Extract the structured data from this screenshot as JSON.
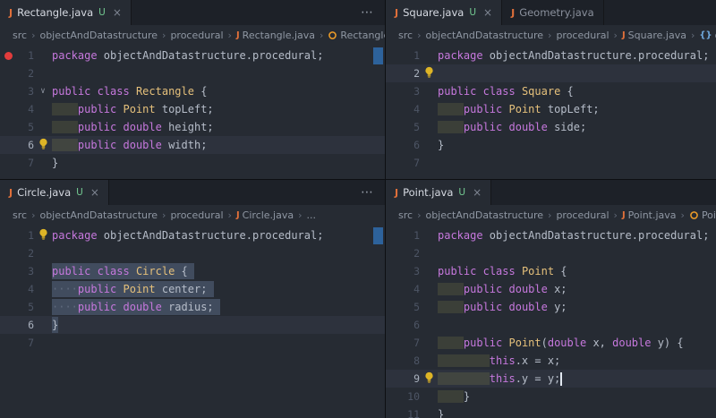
{
  "breadcrumb_separator": "›",
  "icons": {
    "java": "J",
    "namespace": "{}",
    "fold": "∨"
  },
  "colors": {
    "accent_blue": "#2f6cae",
    "git_untracked": "#73c991",
    "keyword": "#c678dd",
    "type": "#e5c07b",
    "lightbulb": "#ddb426",
    "breakpoint": "#e23c3c"
  },
  "panes": [
    {
      "name": "rectangle",
      "tabs": [
        {
          "label": "Rectangle.java",
          "badge": "U",
          "close": "×",
          "active": true
        }
      ],
      "actions": "⋯",
      "breadcrumb": [
        {
          "label": "src"
        },
        {
          "label": "objectAndDatastructure"
        },
        {
          "label": "procedural"
        },
        {
          "label": "Rectangle.java",
          "icon": "java"
        },
        {
          "label": "Rectangle",
          "icon": "class"
        }
      ],
      "scroll_marker": true,
      "lines": [
        {
          "n": 1,
          "breakpoint": true,
          "tokens": [
            [
              "kw",
              "package"
            ],
            [
              "pl",
              " objectAndDatastructure.procedural;"
            ]
          ]
        },
        {
          "n": 2
        },
        {
          "n": 3,
          "fold": true,
          "tokens": [
            [
              "kw",
              "public"
            ],
            [
              "pl",
              " "
            ],
            [
              "kw",
              "class"
            ],
            [
              "pl",
              " "
            ],
            [
              "ty",
              "Rectangle"
            ],
            [
              "pl",
              " {"
            ]
          ]
        },
        {
          "n": 4,
          "tokens": [
            [
              "ws",
              "    "
            ],
            [
              "kw",
              "public"
            ],
            [
              "pl",
              " "
            ],
            [
              "ty",
              "Point"
            ],
            [
              "pl",
              " topLeft;"
            ]
          ]
        },
        {
          "n": 5,
          "tokens": [
            [
              "ws",
              "    "
            ],
            [
              "kw",
              "public"
            ],
            [
              "pl",
              " "
            ],
            [
              "kw",
              "double"
            ],
            [
              "pl",
              " height;"
            ]
          ]
        },
        {
          "n": 6,
          "bulb": true,
          "current": true,
          "tokens": [
            [
              "ws",
              "    "
            ],
            [
              "kw",
              "public"
            ],
            [
              "pl",
              " "
            ],
            [
              "kw",
              "double"
            ],
            [
              "pl",
              " width;"
            ]
          ]
        },
        {
          "n": 7,
          "tokens": [
            [
              "pl",
              "}"
            ]
          ]
        }
      ]
    },
    {
      "name": "square",
      "tabs": [
        {
          "label": "Square.java",
          "badge": "U",
          "close": "×",
          "active": true
        },
        {
          "label": "Geometry.java",
          "active": false
        }
      ],
      "actions": null,
      "breadcrumb": [
        {
          "label": "src"
        },
        {
          "label": "objectAndDatastructure"
        },
        {
          "label": "procedural"
        },
        {
          "label": "Square.java",
          "icon": "java"
        },
        {
          "label": "ob",
          "icon": "namespace"
        }
      ],
      "scroll_marker": false,
      "lines": [
        {
          "n": 1,
          "tokens": [
            [
              "kw",
              "package"
            ],
            [
              "pl",
              " objectAndDatastructure.procedural;"
            ]
          ]
        },
        {
          "n": 2,
          "bulb": true,
          "current": true
        },
        {
          "n": 3,
          "tokens": [
            [
              "kw",
              "public"
            ],
            [
              "pl",
              " "
            ],
            [
              "kw",
              "class"
            ],
            [
              "pl",
              " "
            ],
            [
              "ty",
              "Square"
            ],
            [
              "pl",
              " {"
            ]
          ]
        },
        {
          "n": 4,
          "tokens": [
            [
              "ws",
              "    "
            ],
            [
              "kw",
              "public"
            ],
            [
              "pl",
              " "
            ],
            [
              "ty",
              "Point"
            ],
            [
              "pl",
              " topLeft;"
            ]
          ]
        },
        {
          "n": 5,
          "tokens": [
            [
              "ws",
              "    "
            ],
            [
              "kw",
              "public"
            ],
            [
              "pl",
              " "
            ],
            [
              "kw",
              "double"
            ],
            [
              "pl",
              " side;"
            ]
          ]
        },
        {
          "n": 6,
          "tokens": [
            [
              "pl",
              "}"
            ]
          ]
        },
        {
          "n": 7
        }
      ]
    },
    {
      "name": "circle",
      "tabs": [
        {
          "label": "Circle.java",
          "badge": "U",
          "close": "×",
          "active": true
        }
      ],
      "actions": "⋯",
      "breadcrumb": [
        {
          "label": "src"
        },
        {
          "label": "objectAndDatastructure"
        },
        {
          "label": "procedural"
        },
        {
          "label": "Circle.java",
          "icon": "java"
        },
        {
          "label": "..."
        }
      ],
      "scroll_marker": true,
      "lines": [
        {
          "n": 1,
          "bulb": true,
          "tokens": [
            [
              "kw",
              "package"
            ],
            [
              "pl",
              " objectAndDatastructure.procedural;"
            ]
          ]
        },
        {
          "n": 2
        },
        {
          "n": 3,
          "sel": true,
          "selnl": true,
          "tokens": [
            [
              "kw",
              "public"
            ],
            [
              "pl",
              " "
            ],
            [
              "kw",
              "class"
            ],
            [
              "pl",
              " "
            ],
            [
              "ty",
              "Circle"
            ],
            [
              "pl",
              " {"
            ]
          ]
        },
        {
          "n": 4,
          "sel": true,
          "selnl": true,
          "tokens": [
            [
              "dots",
              "····"
            ],
            [
              "kw",
              "public"
            ],
            [
              "pl",
              " "
            ],
            [
              "ty",
              "Point"
            ],
            [
              "pl",
              " center;"
            ]
          ]
        },
        {
          "n": 5,
          "sel": true,
          "selnl": true,
          "tokens": [
            [
              "dots",
              "····"
            ],
            [
              "kw",
              "public"
            ],
            [
              "pl",
              " "
            ],
            [
              "kw",
              "double"
            ],
            [
              "pl",
              " radius;"
            ]
          ]
        },
        {
          "n": 6,
          "sel": true,
          "current": true,
          "tokens": [
            [
              "pl",
              "}"
            ]
          ]
        },
        {
          "n": 7
        }
      ]
    },
    {
      "name": "point",
      "tabs": [
        {
          "label": "Point.java",
          "badge": "U",
          "close": "×",
          "active": true
        }
      ],
      "actions": null,
      "breadcrumb": [
        {
          "label": "src"
        },
        {
          "label": "objectAndDatastructure"
        },
        {
          "label": "procedural"
        },
        {
          "label": "Point.java",
          "icon": "java"
        },
        {
          "label": "Poin",
          "icon": "class"
        }
      ],
      "scroll_marker": false,
      "lines": [
        {
          "n": 1,
          "tokens": [
            [
              "kw",
              "package"
            ],
            [
              "pl",
              " objectAndDatastructure.procedural;"
            ]
          ]
        },
        {
          "n": 2
        },
        {
          "n": 3,
          "tokens": [
            [
              "kw",
              "public"
            ],
            [
              "pl",
              " "
            ],
            [
              "kw",
              "class"
            ],
            [
              "pl",
              " "
            ],
            [
              "ty",
              "Point"
            ],
            [
              "pl",
              " {"
            ]
          ]
        },
        {
          "n": 4,
          "tokens": [
            [
              "ws",
              "    "
            ],
            [
              "kw",
              "public"
            ],
            [
              "pl",
              " "
            ],
            [
              "kw",
              "double"
            ],
            [
              "pl",
              " x;"
            ]
          ]
        },
        {
          "n": 5,
          "tokens": [
            [
              "ws",
              "    "
            ],
            [
              "kw",
              "public"
            ],
            [
              "pl",
              " "
            ],
            [
              "kw",
              "double"
            ],
            [
              "pl",
              " y;"
            ]
          ]
        },
        {
          "n": 6
        },
        {
          "n": 7,
          "tokens": [
            [
              "ws",
              "    "
            ],
            [
              "kw",
              "public"
            ],
            [
              "pl",
              " "
            ],
            [
              "ty",
              "Point"
            ],
            [
              "pl",
              "("
            ],
            [
              "kw",
              "double"
            ],
            [
              "pl",
              " x, "
            ],
            [
              "kw",
              "double"
            ],
            [
              "pl",
              " y) {"
            ]
          ]
        },
        {
          "n": 8,
          "tokens": [
            [
              "ws",
              "        "
            ],
            [
              "kw",
              "this"
            ],
            [
              "pl",
              ".x = x;"
            ]
          ]
        },
        {
          "n": 9,
          "bulb": true,
          "current": true,
          "cursor": true,
          "tokens": [
            [
              "ws",
              "        "
            ],
            [
              "kw",
              "this"
            ],
            [
              "pl",
              ".y = y;"
            ]
          ]
        },
        {
          "n": 10,
          "tokens": [
            [
              "ws",
              "    "
            ],
            [
              "pl",
              "}"
            ]
          ]
        },
        {
          "n": 11,
          "tokens": [
            [
              "pl",
              "}"
            ]
          ]
        }
      ]
    }
  ]
}
